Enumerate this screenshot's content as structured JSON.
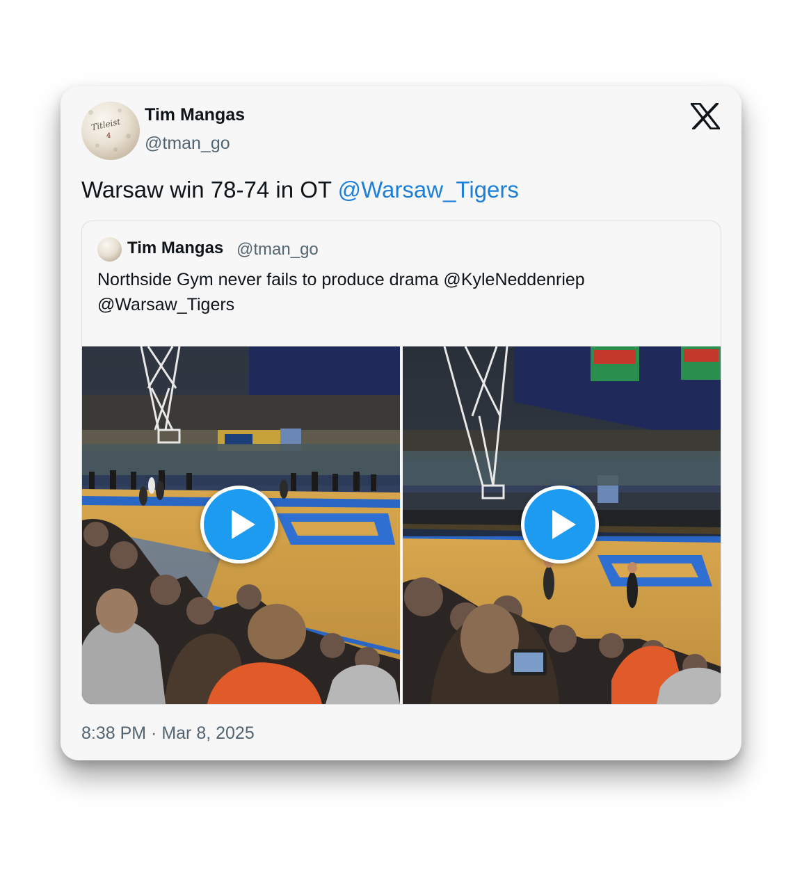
{
  "author": {
    "name": "Tim Mangas",
    "handle": "@tman_go",
    "avatar_brand": "Titleist",
    "avatar_number": "4"
  },
  "tweet": {
    "text": "Warsaw win 78-74 in OT ",
    "mention": "@Warsaw_Tigers",
    "timestamp": "8:38 PM · Mar 8, 2025"
  },
  "quoted_tweet": {
    "name": "Tim Mangas",
    "handle": "@tman_go",
    "text": "Northside Gym never fails to produce drama @KyleNeddenriep @Warsaw_Tigers"
  },
  "icons": {
    "logo": "x-logo-icon",
    "play": "play-icon"
  },
  "colors": {
    "link": "#1d7fd8",
    "play_button": "#1d9bf0",
    "text": "#0f1419",
    "muted": "#536471"
  }
}
